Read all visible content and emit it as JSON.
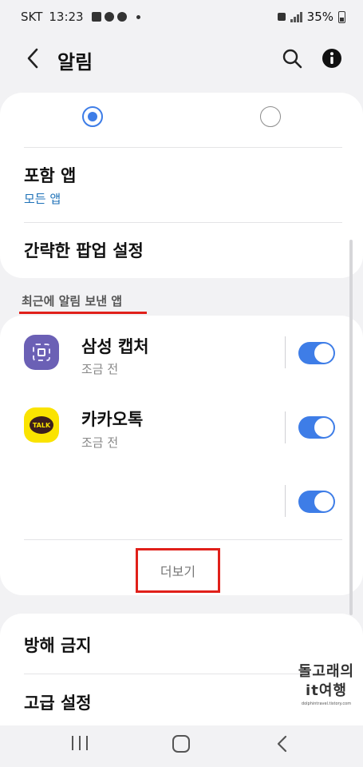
{
  "status_bar": {
    "carrier": "SKT",
    "time": "13:23",
    "battery": "35%"
  },
  "app_bar": {
    "title": "알림"
  },
  "popup_style": {
    "selected_index": 0
  },
  "included_apps": {
    "title": "포함 앱",
    "value": "모든 앱"
  },
  "brief_popup": {
    "title": "간략한 팝업 설정"
  },
  "recent": {
    "header": "최근에 알림 보낸 앱",
    "apps": [
      {
        "name": "삼성 캡처",
        "time": "조금 전",
        "enabled": true,
        "icon": "samsung-capture-icon"
      },
      {
        "name": "카카오톡",
        "time": "조금 전",
        "enabled": true,
        "icon": "kakaotalk-icon"
      },
      {
        "name": "",
        "time": "",
        "enabled": true,
        "icon": ""
      }
    ],
    "more_label": "더보기",
    "kakao_icon_text": "TALK"
  },
  "bottom_items": {
    "dnd": "방해 금지",
    "advanced": "고급 설정"
  },
  "watermark": {
    "line1": "돌고래의",
    "line2": "it여행",
    "line3": "dolphintravel.tistory.com"
  },
  "colors": {
    "accent": "#3e7de7",
    "highlight_red": "#e0201a",
    "link_blue": "#1f72b8"
  }
}
